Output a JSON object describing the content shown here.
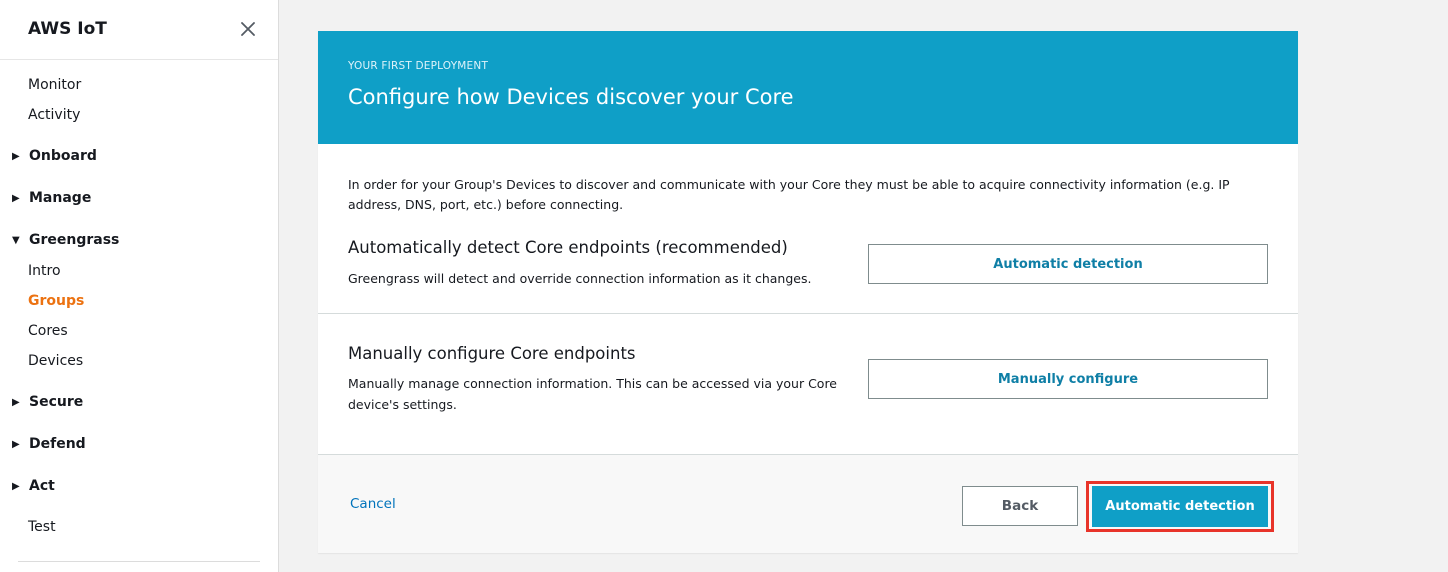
{
  "sidebar": {
    "title": "AWS IoT",
    "close_icon": "close-icon",
    "items": [
      {
        "label": "Monitor",
        "type": "link"
      },
      {
        "label": "Activity",
        "type": "link"
      },
      {
        "label": "Onboard",
        "type": "section",
        "expanded": false
      },
      {
        "label": "Manage",
        "type": "section",
        "expanded": false
      },
      {
        "label": "Greengrass",
        "type": "section",
        "expanded": true
      },
      {
        "label": "Intro",
        "type": "link"
      },
      {
        "label": "Groups",
        "type": "link",
        "active": true
      },
      {
        "label": "Cores",
        "type": "link"
      },
      {
        "label": "Devices",
        "type": "link"
      },
      {
        "label": "Secure",
        "type": "section",
        "expanded": false
      },
      {
        "label": "Defend",
        "type": "section",
        "expanded": false
      },
      {
        "label": "Act",
        "type": "section",
        "expanded": false
      },
      {
        "label": "Test",
        "type": "link"
      }
    ]
  },
  "hero": {
    "kicker": "YOUR FIRST DEPLOYMENT",
    "title": "Configure how Devices discover your Core"
  },
  "intro": "In order for your Group's Devices to discover and communicate with your Core they must be able to acquire connectivity information (e.g. IP address, DNS, port, etc.) before connecting.",
  "options": [
    {
      "title": "Automatically detect Core endpoints (recommended)",
      "description": "Greengrass will detect and override connection information as it changes.",
      "button": "Automatic detection"
    },
    {
      "title": "Manually configure Core endpoints",
      "description": "Manually manage connection information. This can be accessed via your Core device's settings.",
      "button": "Manually configure"
    }
  ],
  "footer": {
    "cancel": "Cancel",
    "back": "Back",
    "primary": "Automatic detection"
  },
  "colors": {
    "accent": "#0f9fc7",
    "active_nav": "#ec7211",
    "highlight": "#e8342a",
    "link": "#0073bb"
  }
}
